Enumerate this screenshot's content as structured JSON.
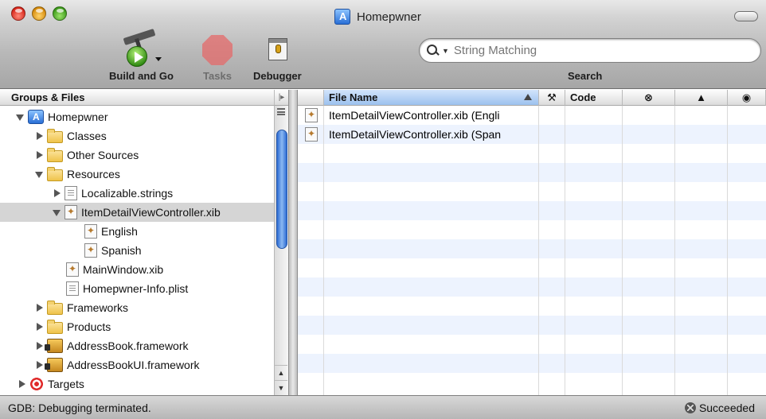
{
  "window": {
    "title": "Homepwner"
  },
  "toolbar": {
    "build_and_go": "Build and Go",
    "tasks": "Tasks",
    "debugger": "Debugger",
    "search_placeholder": "String Matching",
    "search_label": "Search"
  },
  "sidebar": {
    "header": "Groups & Files",
    "items": [
      {
        "label": "Homepwner",
        "icon": "project-icon",
        "expanded": true
      },
      {
        "label": "Classes",
        "icon": "folder-icon",
        "expanded": false
      },
      {
        "label": "Other Sources",
        "icon": "folder-icon",
        "expanded": false
      },
      {
        "label": "Resources",
        "icon": "folder-icon",
        "expanded": true
      },
      {
        "label": "Localizable.strings",
        "icon": "strings-file-icon",
        "expanded": false
      },
      {
        "label": "ItemDetailViewController.xib",
        "icon": "xib-file-icon",
        "expanded": true,
        "selected": true
      },
      {
        "label": "English",
        "icon": "xib-file-icon"
      },
      {
        "label": "Spanish",
        "icon": "xib-file-icon"
      },
      {
        "label": "MainWindow.xib",
        "icon": "xib-file-icon"
      },
      {
        "label": "Homepwner-Info.plist",
        "icon": "plist-file-icon"
      },
      {
        "label": "Frameworks",
        "icon": "folder-icon",
        "expanded": false
      },
      {
        "label": "Products",
        "icon": "folder-icon",
        "expanded": false
      },
      {
        "label": "AddressBook.framework",
        "icon": "framework-icon",
        "expanded": false
      },
      {
        "label": "AddressBookUI.framework",
        "icon": "framework-icon",
        "expanded": false
      },
      {
        "label": "Targets",
        "icon": "target-icon",
        "expanded": false
      }
    ]
  },
  "file_list": {
    "columns": {
      "file_name": "File Name",
      "build": "hammer-icon",
      "code": "Code",
      "errors": "error-icon",
      "warnings": "warning-icon",
      "target": "target-check-icon"
    },
    "rows": [
      {
        "file_name": "ItemDetailViewController.xib (Engli"
      },
      {
        "file_name": "ItemDetailViewController.xib (Span"
      }
    ]
  },
  "status": {
    "message": "GDB: Debugging terminated.",
    "result": "Succeeded"
  },
  "colors": {
    "selection_gray": "#d5d5d5",
    "stripe_blue": "#edf3fe",
    "sorted_header": "#9cc1ee",
    "scroll_thumb": "#2d6bd3"
  }
}
